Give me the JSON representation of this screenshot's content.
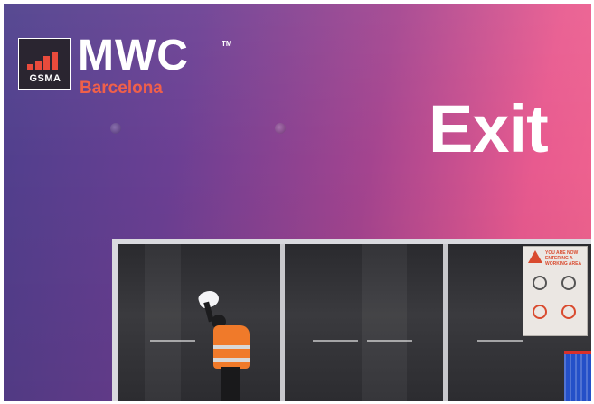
{
  "logo": {
    "gsma_label": "GSMA",
    "brand_label": "MWC",
    "trademark": "TM",
    "city_label": "Barcelona"
  },
  "sign": {
    "exit_label": "Exit"
  },
  "safety_notice": {
    "heading": "YOU ARE NOW ENTERING A WORKING AREA"
  },
  "colors": {
    "wall_left": "#4d3f8c",
    "wall_right": "#f2668f",
    "barcelona_accent": "#f0604a",
    "vest": "#f07a2a",
    "cart": "#2450c8"
  }
}
